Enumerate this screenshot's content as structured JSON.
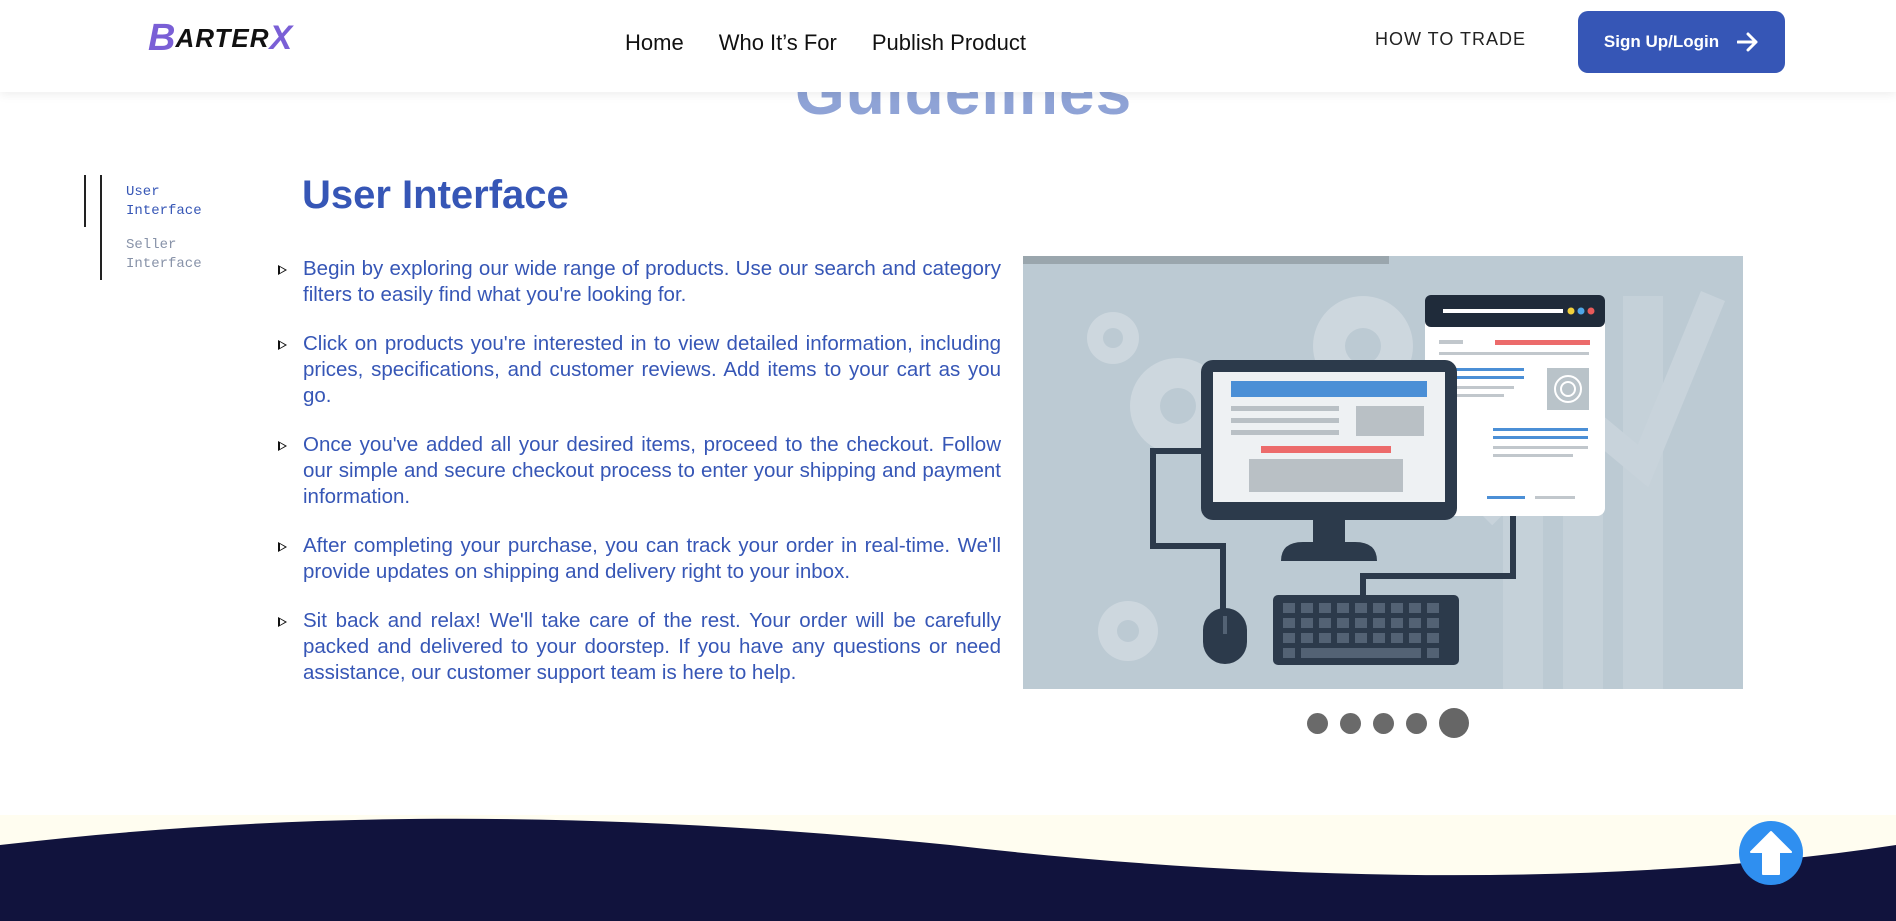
{
  "header": {
    "logo": {
      "b": "B",
      "rest": "ARTER",
      "x": "X"
    },
    "nav": [
      {
        "label": "Home"
      },
      {
        "label": "Who It’s For"
      },
      {
        "label": "Publish Product"
      }
    ],
    "how_to_trade": "HOW TO TRADE",
    "signup_label": "Sign Up/Login"
  },
  "bg_heading": "Guidelines",
  "side_nav": {
    "items": [
      {
        "label": "User Interface",
        "active": true
      },
      {
        "label": "Seller Interface",
        "active": false
      }
    ]
  },
  "main": {
    "title": "User Interface",
    "steps": [
      "Begin by exploring our wide range of products. Use our search and category filters to easily find what you're looking for.",
      "Click on products you're interested in to view detailed information, including prices, specifications, and customer reviews. Add items to your cart as you go.",
      "Once you've added all your desired items, proceed to the checkout. Follow our simple and secure checkout process to enter your shipping and payment information.",
      "After completing your purchase, you can track your order in real-time. We'll provide updates on shipping and delivery right to your inbox.",
      "Sit back and relax! We'll take care of the rest. Your order will be carefully packed and delivered to your doorstep. If you have any questions or need assistance, our customer support team is here to help."
    ]
  },
  "carousel": {
    "slide_count": 5,
    "active_slide": 5
  },
  "colors": {
    "primary": "#3656b6",
    "footer_navy": "#11133d",
    "footer_cream": "#fffdf0",
    "scroll_button": "#2f8ff0"
  }
}
